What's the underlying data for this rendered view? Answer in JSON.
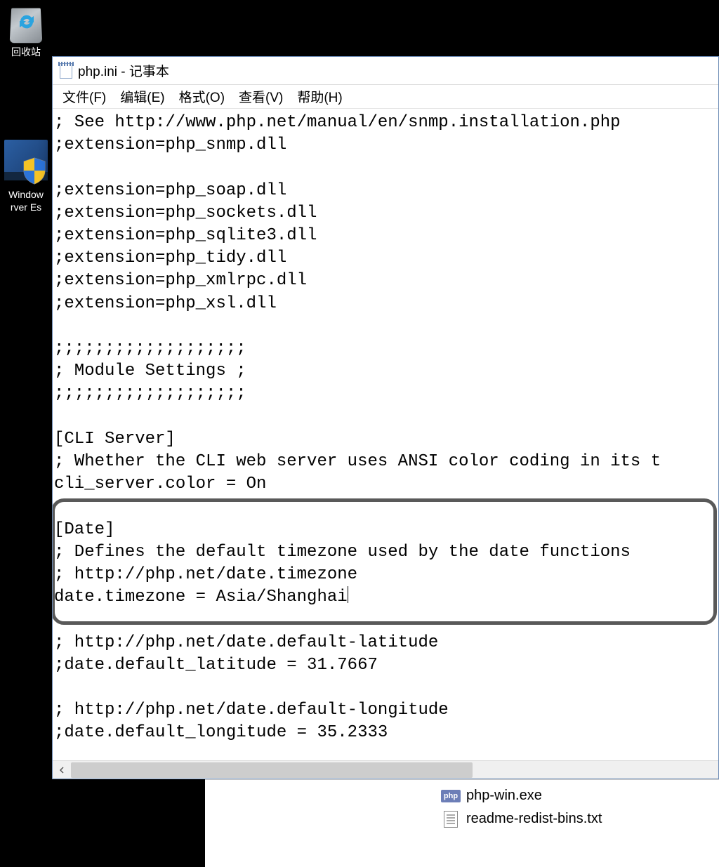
{
  "desktop": {
    "recycle_bin_label": "回收站",
    "server_icon_label_line1": "Window",
    "server_icon_label_line2": "rver Es"
  },
  "notepad": {
    "title": "php.ini - 记事本",
    "menus": {
      "file": "文件(F)",
      "edit": "编辑(E)",
      "format": "格式(O)",
      "view": "查看(V)",
      "help": "帮助(H)"
    },
    "content": "; See http://www.php.net/manual/en/snmp.installation.php\n;extension=php_snmp.dll\n\n;extension=php_soap.dll\n;extension=php_sockets.dll\n;extension=php_sqlite3.dll\n;extension=php_tidy.dll\n;extension=php_xmlrpc.dll\n;extension=php_xsl.dll\n\n;;;;;;;;;;;;;;;;;;;\n; Module Settings ;\n;;;;;;;;;;;;;;;;;;;\n\n[CLI Server]\n; Whether the CLI web server uses ANSI color coding in its t\ncli_server.color = On\n\n[Date]\n; Defines the default timezone used by the date functions\n; http://php.net/date.timezone\ndate.timezone = Asia/Shanghai\n\n; http://php.net/date.default-latitude\n;date.default_latitude = 31.7667\n\n; http://php.net/date.default-longitude\n;date.default_longitude = 35.2333\n"
  },
  "explorer": {
    "files": [
      {
        "name": "php-win.exe",
        "icon": "php"
      },
      {
        "name": "readme-redist-bins.txt",
        "icon": "txt"
      }
    ]
  }
}
